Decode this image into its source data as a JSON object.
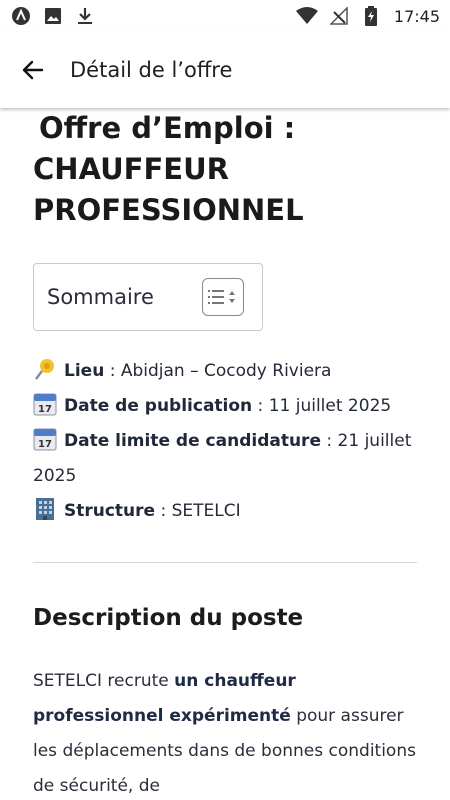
{
  "status_bar": {
    "time": "17:45",
    "left_icons": [
      "app-notification-icon",
      "image-icon",
      "download-icon"
    ],
    "right_icons": [
      "wifi-icon",
      "no-signal-icon",
      "battery-charging-icon"
    ]
  },
  "app_bar": {
    "title": "Détail de l’offre",
    "back_icon": "arrow-back-icon"
  },
  "offer": {
    "title_line1": "Offre d’Emploi :",
    "title_line2": "CHAUFFEUR",
    "title_line3": "PROFESSIONNEL",
    "toc_label": "Sommaire",
    "meta": [
      {
        "icon": "pin-icon",
        "label": "Lieu",
        "separator": " : ",
        "value": "Abidjan – Cocody Riviera"
      },
      {
        "icon": "calendar-icon",
        "label": "Date de publication",
        "separator": " : ",
        "value": "11 juillet 2025"
      },
      {
        "icon": "calendar-icon",
        "label": "Date limite de candidature",
        "separator": " : ",
        "value": "21 juillet 2025"
      },
      {
        "icon": "building-icon",
        "label": "Structure",
        "separator": " : ",
        "value": "SETELCI"
      }
    ],
    "section_title": "Description du poste",
    "description": {
      "part1": "SETELCI recrute ",
      "bold": "un chauffeur professionnel expérimenté",
      "part2": " pour assurer les déplacements dans de bonnes conditions de sécurité, de"
    }
  }
}
